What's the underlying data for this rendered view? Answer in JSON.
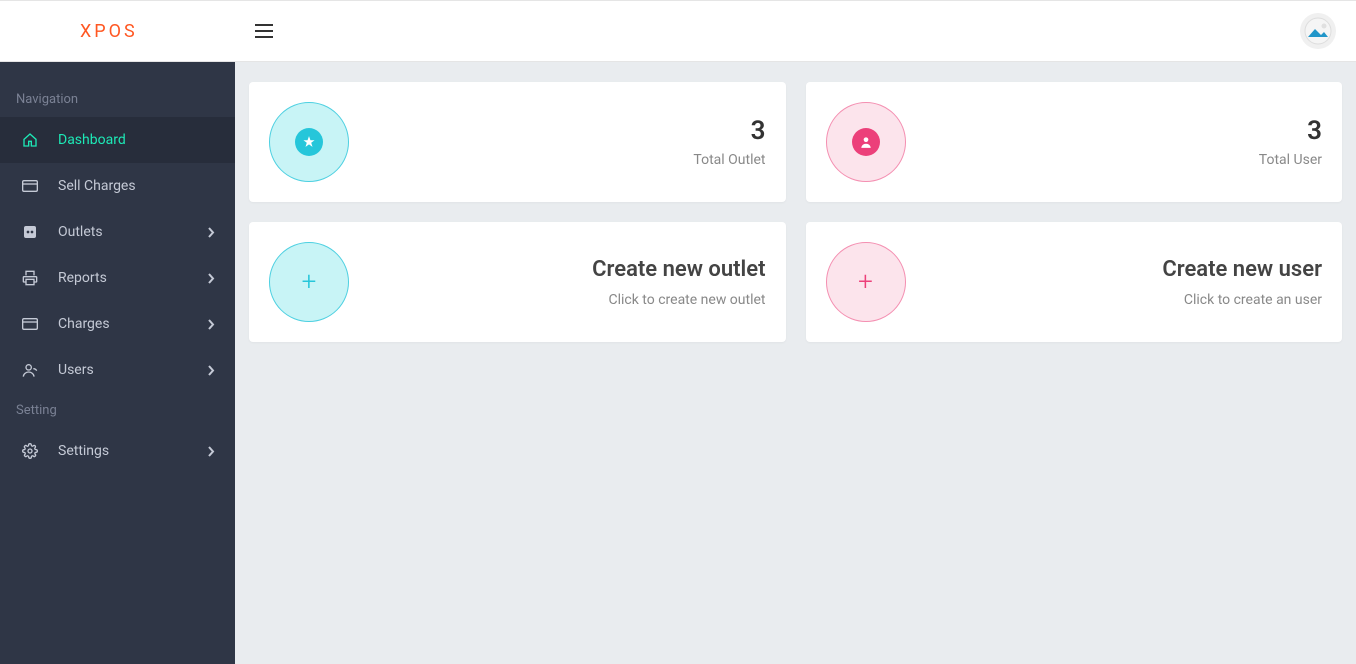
{
  "brand": "XPOS",
  "sidebar": {
    "section1_label": "Navigation",
    "section2_label": "Setting",
    "items": [
      {
        "label": "Dashboard"
      },
      {
        "label": "Sell Charges"
      },
      {
        "label": "Outlets"
      },
      {
        "label": "Reports"
      },
      {
        "label": "Charges"
      },
      {
        "label": "Users"
      }
    ],
    "settings_label": "Settings"
  },
  "stats": {
    "outlet": {
      "value": "3",
      "label": "Total Outlet"
    },
    "user": {
      "value": "3",
      "label": "Total User"
    }
  },
  "actions": {
    "new_outlet": {
      "title": "Create new outlet",
      "sub": "Click to create new outlet"
    },
    "new_user": {
      "title": "Create new user",
      "sub": "Click to create an user"
    }
  }
}
